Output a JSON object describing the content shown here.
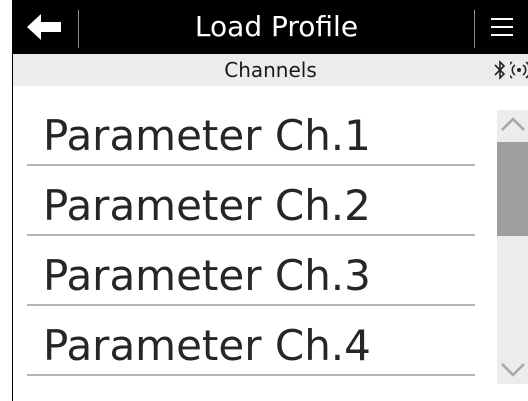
{
  "header": {
    "title": "Load Profile",
    "back_icon": "arrow-left-icon",
    "menu_icon": "hamburger-menu-icon"
  },
  "subheader": {
    "title": "Channels",
    "status_icons": [
      "bluetooth-icon",
      "wireless-signal-icon"
    ]
  },
  "list": {
    "items": [
      {
        "label": "Parameter Ch.1"
      },
      {
        "label": "Parameter Ch.2"
      },
      {
        "label": "Parameter Ch.3"
      },
      {
        "label": "Parameter Ch.4"
      }
    ]
  },
  "scrollbar": {
    "up_icon": "chevron-up-icon",
    "down_icon": "chevron-down-icon"
  },
  "colors": {
    "header_bg": "#000000",
    "header_text": "#ffffff",
    "subheader_bg": "#ececec",
    "item_text": "#262626",
    "divider": "#b3b3b3",
    "scroll_track": "#ececec",
    "scroll_thumb": "#9e9e9e"
  }
}
